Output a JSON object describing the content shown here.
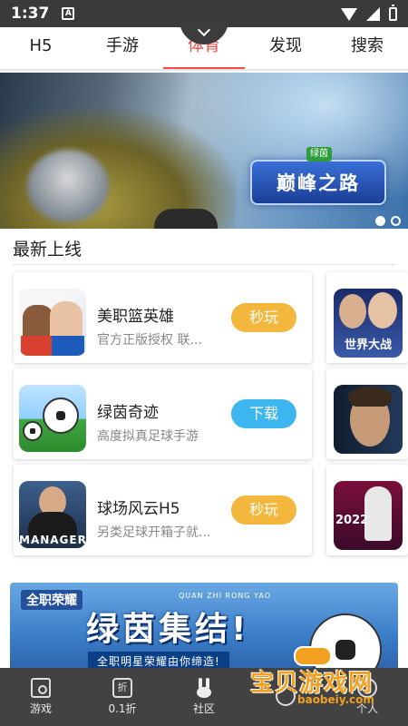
{
  "status_bar": {
    "time": "1:37",
    "notification_glyph": "A"
  },
  "tabs": [
    {
      "label": "H5",
      "active": false
    },
    {
      "label": "手游",
      "active": false
    },
    {
      "label": "体育",
      "active": true
    },
    {
      "label": "发现",
      "active": false
    },
    {
      "label": "搜索",
      "active": false
    }
  ],
  "banner": {
    "logo_text": "巅峰之路",
    "logo_badge": "绿茵",
    "dots_count": 2,
    "active_dot": 0
  },
  "section": {
    "title": "最新上线"
  },
  "games": [
    {
      "name": "美职篮英雄",
      "desc": "官方正版授权 联...",
      "action": "秒玩",
      "action_type": "play",
      "icon": "basketball-heroes-icon"
    },
    {
      "name": "绿茵奇迹",
      "desc": "高度拟真足球手游",
      "action": "下载",
      "action_type": "download",
      "icon": "soccer-miracle-icon"
    },
    {
      "name": "球场风云H5",
      "desc": "另类足球开箱子就...",
      "action": "秒玩",
      "action_type": "play",
      "icon": "manager-game-icon"
    }
  ],
  "icon_labels": {
    "manager": "MANAGER",
    "world": "世界大战",
    "year": "2022"
  },
  "banner2": {
    "tag": "全职荣耀",
    "pinyin": "QUAN ZHI RONG YAO",
    "headline": "绿茵集结!",
    "strip": "全职明星荣耀由你缔造!"
  },
  "bottom_nav": [
    {
      "label": "游戏",
      "icon": "home-icon"
    },
    {
      "label": "0.1折",
      "icon": "discount-icon"
    },
    {
      "label": "社区",
      "icon": "rabbit-icon"
    },
    {
      "label": "",
      "icon": "user-icon"
    },
    {
      "label": "个人",
      "icon": "profile-icon"
    }
  ],
  "watermark": {
    "title": "宝贝游戏网",
    "domain": "baobeiy.com"
  },
  "colors": {
    "accent": "#f04a4a",
    "play_button": "#f2b73c",
    "download_button": "#3db6ef",
    "status_bar": "#3a3a3a",
    "bottom_nav": "#424242"
  }
}
